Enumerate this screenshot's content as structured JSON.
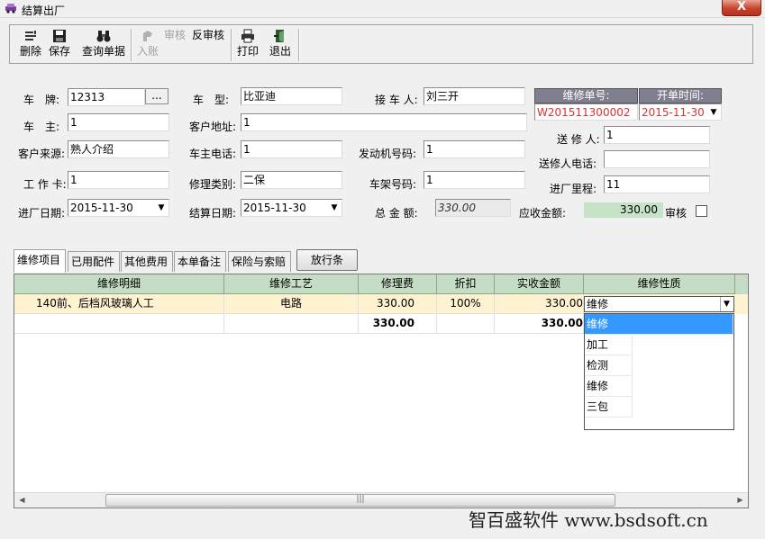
{
  "window": {
    "title": "结算出厂",
    "close_label": "X"
  },
  "toolbar": {
    "delete": "删除",
    "save": "保存",
    "query": "查询单据",
    "post": "入账",
    "audit": "审核",
    "unaudit": "反审核",
    "print": "打印",
    "exit": "退出"
  },
  "form": {
    "plate_label": "车　牌:",
    "plate": "12313",
    "plate_btn": "...",
    "model_label": "车　型:",
    "model": "比亚迪",
    "receiver_label": "接 车 人:",
    "receiver": "刘三开",
    "owner_label": "车　主:",
    "owner": "1",
    "address_label": "客户地址:",
    "address": "1",
    "source_label": "客户来源:",
    "source": "熟人介绍",
    "phone_label": "车主电话:",
    "phone": "1",
    "engine_label": "发动机号码:",
    "engine": "1",
    "card_label": "工 作 卡:",
    "card": "1",
    "repair_type_label": "修理类别:",
    "repair_type": "二保",
    "frame_label": "车架号码:",
    "frame": "1",
    "entry_date_label": "进厂日期:",
    "entry_date": "2015-11-30",
    "settle_date_label": "结算日期:",
    "settle_date": "2015-11-30",
    "total_label": "总 金 额:",
    "total": "330.00",
    "receivable_label": "应收金额:",
    "receivable": "330.00",
    "audit_label": "审核",
    "order_no_label": "维修单号:",
    "order_no": "W201511300002",
    "open_time_label": "开单时间:",
    "open_time": "2015-11-30",
    "sender_label": "送 修 人:",
    "sender": "1",
    "sender_phone_label": "送修人电话:",
    "sender_phone": "",
    "mileage_label": "进厂里程:",
    "mileage": "11"
  },
  "tabs": [
    "维修项目",
    "已用配件",
    "其他费用",
    "本单备注",
    "保险与索赔"
  ],
  "release_button": "放行条",
  "grid": {
    "headers": [
      "维修明细",
      "维修工艺",
      "修理费",
      "折扣",
      "实收金额",
      "维修性质"
    ],
    "rows": [
      [
        "140前、后档风玻璃人工",
        "电路",
        "330.00",
        "100%",
        "330.00",
        "维修"
      ],
      [
        "",
        "",
        "330.00",
        "",
        "330.00",
        ""
      ]
    ]
  },
  "dropdown": {
    "options": [
      "维修",
      "加工",
      "检测",
      "维修",
      "三包"
    ],
    "selected_index": 0
  },
  "watermark": "智百盛软件 www.bsdsoft.cn"
}
